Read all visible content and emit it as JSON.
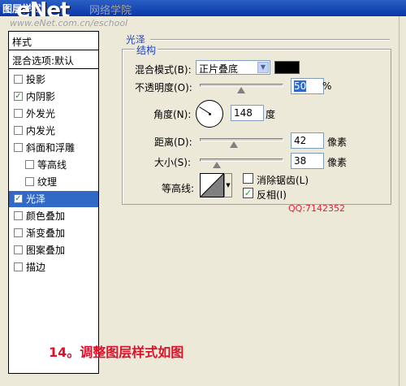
{
  "titlebar": {
    "title": "图层样式"
  },
  "watermark": {
    "logo": "eNet",
    "site_cn": "网络学院",
    "url": "www.eNet.com.cn/eschool"
  },
  "left_panel": {
    "title": "样式",
    "blend_options": "混合选项:默认",
    "items": [
      {
        "label": "投影",
        "checked": false,
        "indent": false,
        "selected": false
      },
      {
        "label": "内阴影",
        "checked": true,
        "indent": false,
        "selected": false
      },
      {
        "label": "外发光",
        "checked": false,
        "indent": false,
        "selected": false
      },
      {
        "label": "内发光",
        "checked": false,
        "indent": false,
        "selected": false
      },
      {
        "label": "斜面和浮雕",
        "checked": false,
        "indent": false,
        "selected": false
      },
      {
        "label": "等高线",
        "checked": false,
        "indent": true,
        "selected": false
      },
      {
        "label": "纹理",
        "checked": false,
        "indent": true,
        "selected": false
      },
      {
        "label": "光泽",
        "checked": true,
        "indent": false,
        "selected": true
      },
      {
        "label": "颜色叠加",
        "checked": false,
        "indent": false,
        "selected": false
      },
      {
        "label": "渐变叠加",
        "checked": false,
        "indent": false,
        "selected": false
      },
      {
        "label": "图案叠加",
        "checked": false,
        "indent": false,
        "selected": false
      },
      {
        "label": "描边",
        "checked": false,
        "indent": false,
        "selected": false
      }
    ]
  },
  "satin": {
    "section_title": "光泽",
    "structure_title": "结构",
    "blend_mode_label": "混合模式(B):",
    "blend_mode_value": "正片叠底",
    "blend_color": "#000000",
    "opacity_label": "不透明度(O):",
    "opacity_value": "50",
    "opacity_unit": "%",
    "angle_label": "角度(N):",
    "angle_value": "148",
    "angle_unit": "度",
    "distance_label": "距离(D):",
    "distance_value": "42",
    "distance_unit": "像素",
    "size_label": "大小(S):",
    "size_value": "38",
    "size_unit": "像素",
    "contour_label": "等高线:",
    "antialias_label": "消除锯齿(L)",
    "antialias_checked": false,
    "invert_label": "反相(I)",
    "invert_checked": true
  },
  "qq_watermark": "QQ:7142352",
  "caption": "14。调整图层样式如图"
}
